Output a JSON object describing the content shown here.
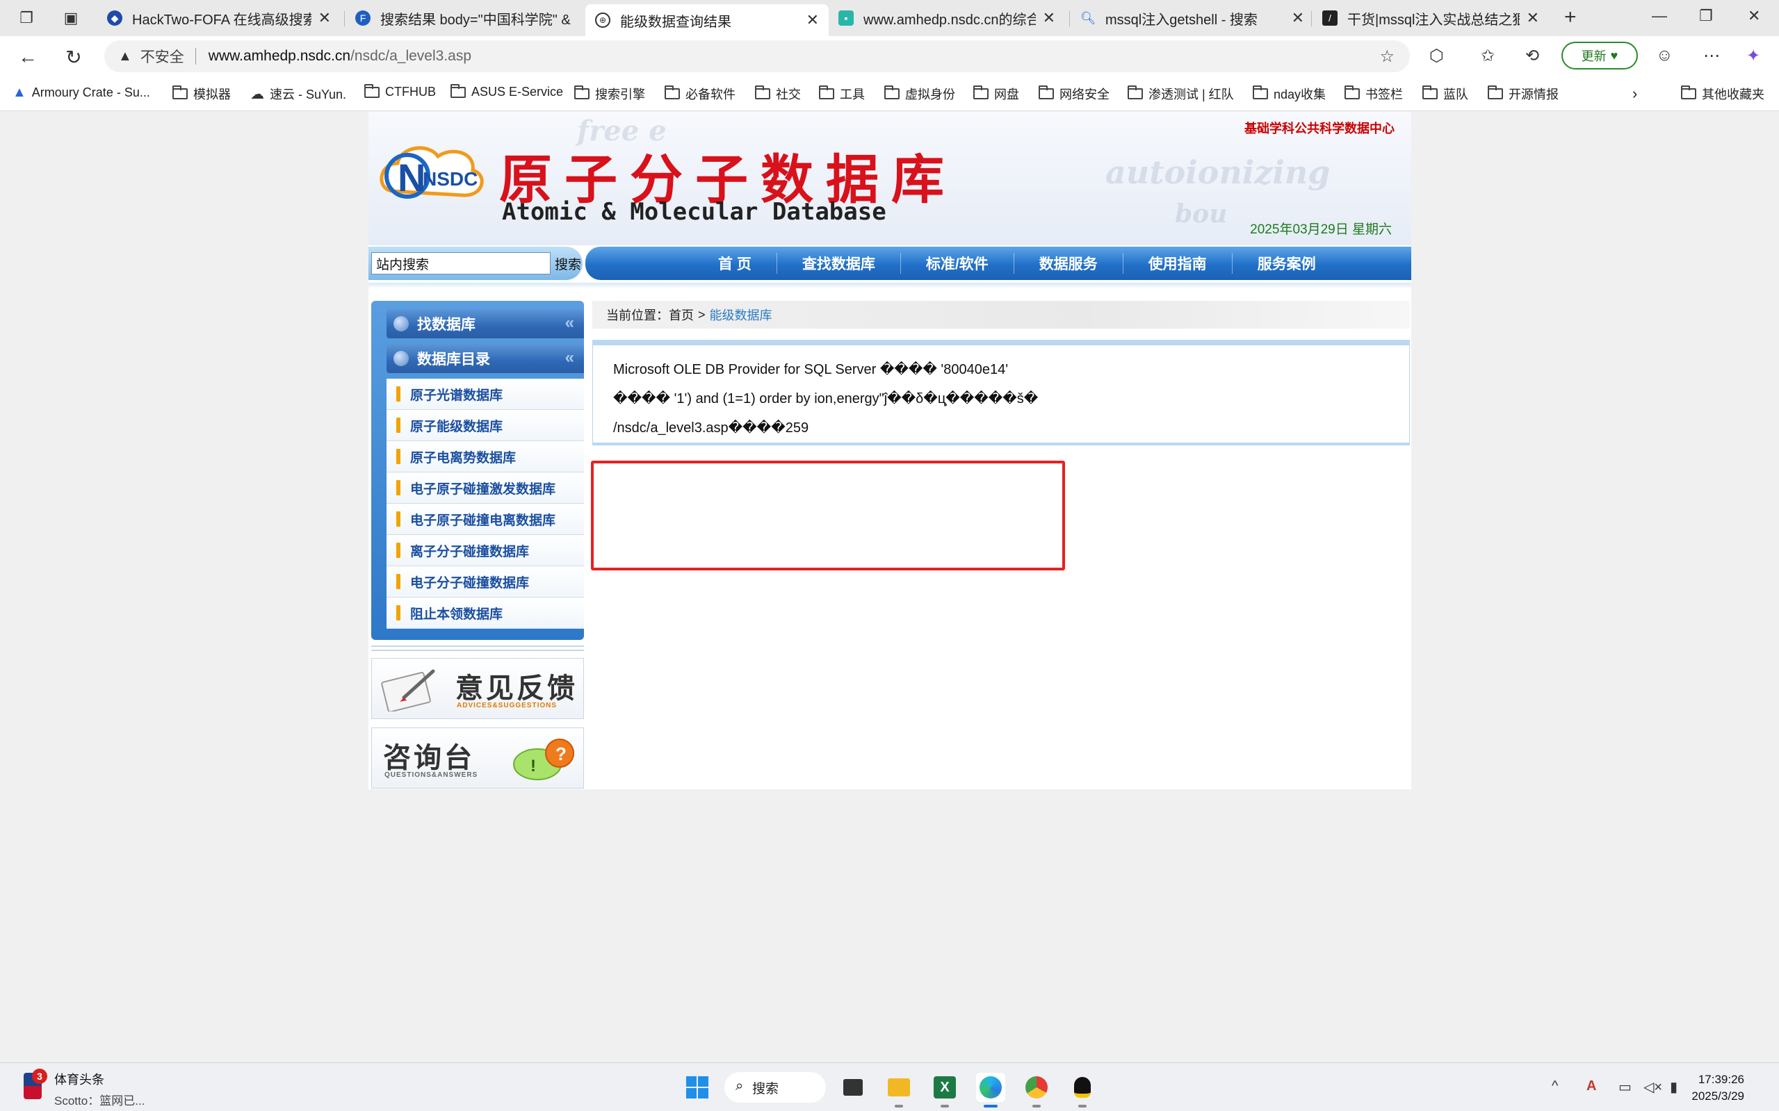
{
  "browser": {
    "tabs": [
      {
        "title": "HackTwo-FOFA 在线高级搜索小",
        "icon": "shield-icon",
        "active": false
      },
      {
        "title": "搜索结果 body=\"中国科学院\" &",
        "icon": "fofa-icon",
        "active": false
      },
      {
        "title": "能级数据查询结果",
        "icon": "globe-icon",
        "active": true
      },
      {
        "title": "www.amhedp.nsdc.cn的综合查询",
        "icon": "site-icon",
        "active": false
      },
      {
        "title": "mssql注入getshell - 搜索",
        "icon": "search-icon",
        "active": false
      },
      {
        "title": "干货|mssql注入实战总结之狠快准",
        "icon": "page-icon",
        "active": false
      }
    ],
    "address": {
      "security_label": "不安全",
      "host": "www.amhedp.nsdc.cn",
      "path": "/nsdc/a_level3.asp"
    },
    "update_label": "更新",
    "bookmarks": [
      {
        "label": "Armoury Crate - Su...",
        "type": "link"
      },
      {
        "label": "模拟器",
        "type": "folder"
      },
      {
        "label": "速云 - SuYun.",
        "type": "link"
      },
      {
        "label": "CTFHUB",
        "type": "folder"
      },
      {
        "label": "ASUS E-Service",
        "type": "folder"
      },
      {
        "label": "搜索引擎",
        "type": "folder"
      },
      {
        "label": "必备软件",
        "type": "folder"
      },
      {
        "label": "社交",
        "type": "folder"
      },
      {
        "label": "工具",
        "type": "folder"
      },
      {
        "label": "虚拟身份",
        "type": "folder"
      },
      {
        "label": "网盘",
        "type": "folder"
      },
      {
        "label": "网络安全",
        "type": "folder"
      },
      {
        "label": "渗透测试 | 红队",
        "type": "folder"
      },
      {
        "label": "nday收集",
        "type": "folder"
      },
      {
        "label": "书签栏",
        "type": "folder"
      },
      {
        "label": "蓝队",
        "type": "folder"
      },
      {
        "label": "开源情报",
        "type": "folder"
      },
      {
        "label": "其他收藏夹",
        "type": "folder"
      }
    ]
  },
  "site": {
    "top_org": "基础学科公共科学数据中心",
    "logo_badge": "NSDC",
    "logo_cn": "原子分子数据库",
    "logo_en": "Atomic & Molecular Database",
    "date": "2025年03月29日 星期六",
    "search": {
      "value": "站内搜索",
      "button": "搜索"
    },
    "nav": [
      "首 页",
      "查找数据库",
      "标准/软件",
      "数据服务",
      "使用指南",
      "服务案例"
    ],
    "sidebar": {
      "find_db": "找数据库",
      "db_catalog": "数据库目录",
      "items": [
        "原子光谱数据库",
        "原子能级数据库",
        "原子电离势数据库",
        "电子原子碰撞激发数据库",
        "电子原子碰撞电离数据库",
        "离子分子碰撞数据库",
        "电子分子碰撞数据库",
        "阻止本领数据库"
      ]
    },
    "promo_feedback": {
      "title": "意见反馈",
      "subtitle": "ADVICES&SUGGESTIONS"
    },
    "promo_qa": {
      "title": "咨询台",
      "subtitle": "QUESTIONS&ANSWERS"
    },
    "breadcrumb": {
      "prefix": "当前位置：",
      "home": "首页",
      "sep": ">",
      "current": "能级数据库"
    },
    "error": {
      "line1": "Microsoft OLE DB Provider for SQL Server ���� '80040e14'",
      "line2": "���� '1') and (1=1) order by ion,energy\"ĵ��δ�ц̧�����š�",
      "line3": "/nsdc/a_level3.asp����259"
    }
  },
  "taskbar": {
    "news_title": "体育头条",
    "news_sub": "Scotto：篮网已...",
    "news_badge": "3",
    "search_label": "搜索",
    "time": "17:39:26",
    "date": "2025/3/29"
  },
  "colors": {
    "brand_red": "#d8111b",
    "nav_blue": "#2170c8",
    "highlight_red": "#e52121",
    "link_blue": "#2a7ac4"
  }
}
